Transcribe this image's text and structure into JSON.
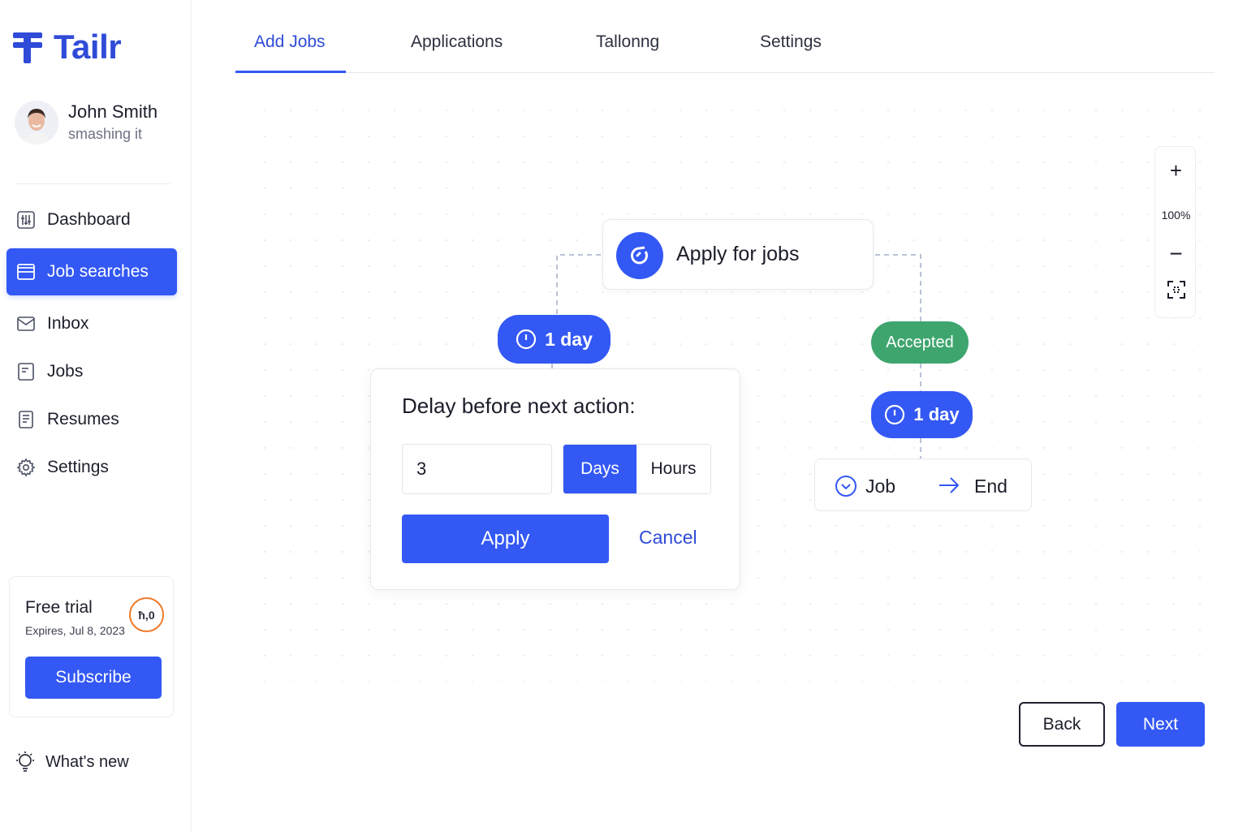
{
  "app": {
    "name": "Tailr"
  },
  "profile": {
    "name": "John Smith",
    "status": "smashing it"
  },
  "sidebar": {
    "items": [
      {
        "label": "Dashboard",
        "icon": "dashboard-icon",
        "active": false
      },
      {
        "label": "Job searches",
        "icon": "layout-icon",
        "active": true
      },
      {
        "label": "Inbox",
        "icon": "mail-icon",
        "active": false
      },
      {
        "label": "Jobs",
        "icon": "document-icon",
        "active": false
      },
      {
        "label": "Resumes",
        "icon": "file-icon",
        "active": false
      },
      {
        "label": "Settings",
        "icon": "gear-icon",
        "active": false
      }
    ],
    "whats_new": "What's new"
  },
  "trial": {
    "title": "Free trial",
    "expires": "Expires, Jul 8, 2023",
    "badge": "ħ,0",
    "subscribe_label": "Subscribe"
  },
  "tabs": [
    {
      "label": "Add Jobs",
      "active": true
    },
    {
      "label": "Applications",
      "active": false
    },
    {
      "label": "Tallonng",
      "active": false
    },
    {
      "label": "Settings",
      "active": false
    }
  ],
  "zoom": {
    "plus": "+",
    "level": "100%",
    "minus": "−"
  },
  "flow": {
    "start_node": "Apply for jobs",
    "left_delay": "1 day",
    "accepted": "Accepted",
    "right_delay": "1 day",
    "job_label": "Job",
    "end_label": "End"
  },
  "delay_popover": {
    "title": "Delay before next action:",
    "value": "3",
    "units": [
      "Days",
      "Hours"
    ],
    "selected_unit": "Days",
    "apply_label": "Apply",
    "cancel_label": "Cancel"
  },
  "footer": {
    "back_label": "Back",
    "next_label": "Next"
  },
  "colors": {
    "primary": "#3358f4",
    "accent_text": "#2f4bd8",
    "accepted": "#3fa56f",
    "trial_ring": "#f07a2a"
  }
}
